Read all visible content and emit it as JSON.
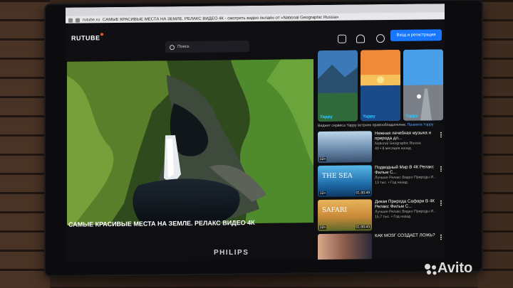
{
  "browser": {
    "url": "rutube.ru",
    "title": "САМЫЕ КРАСИВЫЕ МЕСТА НА ЗЕМЛЕ. РЕЛАКС ВИДЕО 4К - смотреть видео онлайн от «National Geographic Russia»"
  },
  "header": {
    "logo": "RUTUBE",
    "search_placeholder": "Поиск",
    "login_label": "Вход и регистрация"
  },
  "player": {
    "title": "САМЫЕ КРАСИВЫЕ МЕСТА НА ЗЕМЛЕ. РЕЛАКС ВИДЕО 4К"
  },
  "yappy": {
    "card_label": "Yappy",
    "note": "Виджет сервиса Yappy встроен правообладателем.",
    "note_link": "Правила Yappy"
  },
  "recommendations": [
    {
      "title": "Нежная лечебная музыка и природа дл...",
      "channel": "National Geographic Russia",
      "meta": "40 • 8 месяцев назад",
      "badge": "12+",
      "thumb_text": "",
      "duration": ""
    },
    {
      "title": "Подводный Мир В 4К Релакс Фильм С...",
      "channel": "Лучшие Релакс Видео Природы И...",
      "meta": "13 тыс. • Год назад",
      "badge": "12+",
      "thumb_text": "THE SEA",
      "duration": "01:00:49"
    },
    {
      "title": "Дикая Природа Сафари В 4К Релакс Фильм С...",
      "channel": "Лучшие Релакс Видео Природы И...",
      "meta": "15,7 тыс. • Год назад",
      "badge": "12+",
      "thumb_text": "SAFARI",
      "duration": "01:00:43"
    },
    {
      "title": "КАК МОЗГ СОЗДАЕТ ЛОЖЬ?",
      "channel": "",
      "meta": "",
      "badge": "",
      "thumb_text": "",
      "duration": ""
    }
  ],
  "tv_brand": "PHILIPS",
  "watermark": "Avito"
}
